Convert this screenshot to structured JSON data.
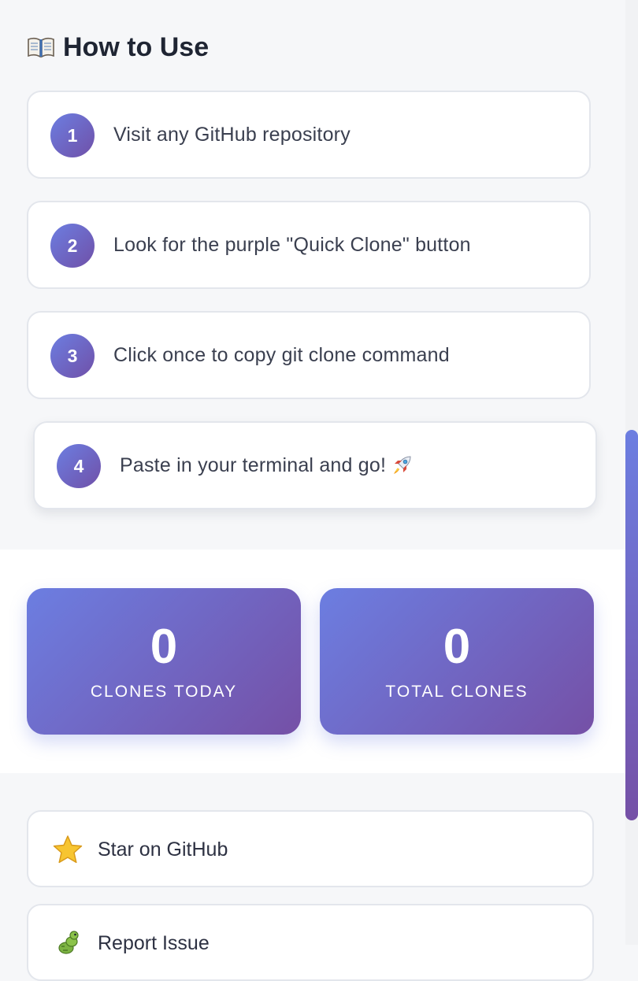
{
  "how_to_use": {
    "title": "How to Use",
    "title_icon": "book-icon",
    "steps": [
      {
        "number": "1",
        "text": "Visit any GitHub repository"
      },
      {
        "number": "2",
        "text": "Look for the purple \"Quick Clone\" button"
      },
      {
        "number": "3",
        "text": "Click once to copy git clone command"
      },
      {
        "number": "4",
        "text": "Paste in your terminal and go!",
        "icon": "rocket-icon"
      }
    ]
  },
  "stats": {
    "clones_today": {
      "value": "0",
      "label": "CLONES TODAY"
    },
    "total_clones": {
      "value": "0",
      "label": "TOTAL CLONES"
    }
  },
  "links": [
    {
      "label": "Star on GitHub",
      "icon": "star-icon"
    },
    {
      "label": "Report Issue",
      "icon": "bug-icon"
    }
  ],
  "colors": {
    "accent_start": "#6c7ee1",
    "accent_end": "#7550a6",
    "background": "#f6f7f9",
    "card_border": "#e3e6ec"
  }
}
